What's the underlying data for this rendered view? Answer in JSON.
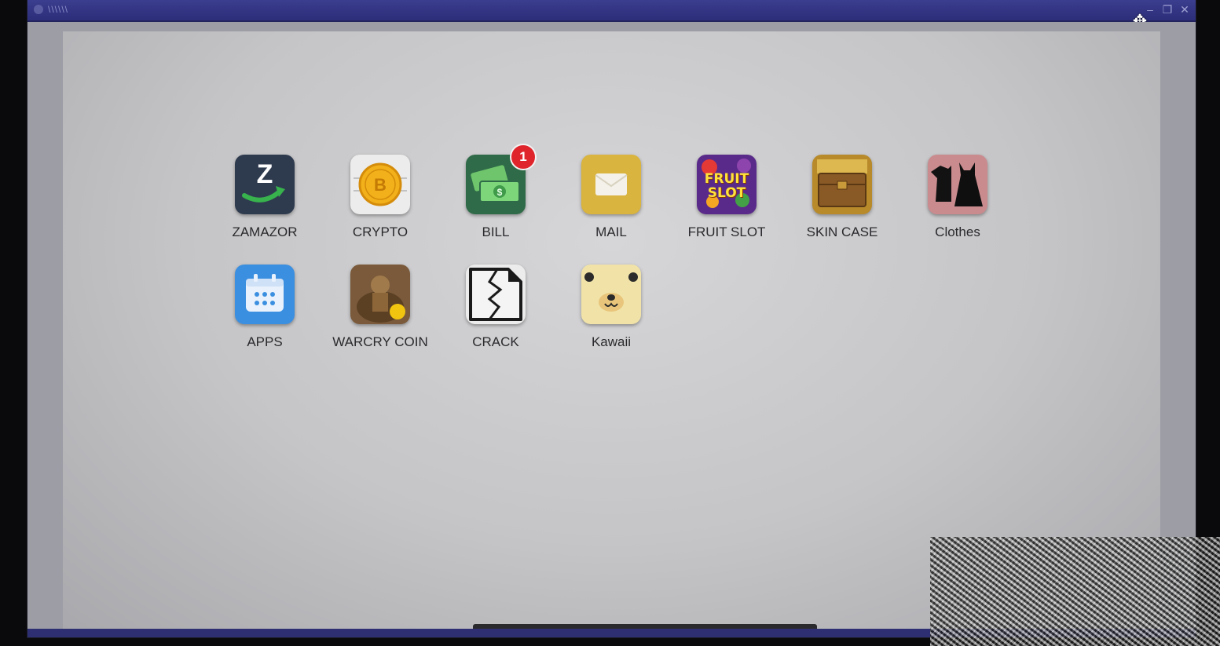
{
  "window": {
    "title": "\\\\\\\\\\\\",
    "minimize_glyph": "–",
    "maximize_glyph": "❐",
    "close_glyph": "✕",
    "move_cursor_glyph": "✥"
  },
  "desktop": {
    "apps": [
      {
        "id": "zamazor",
        "label": "ZAMAZOR",
        "icon": "zamazor-icon",
        "color": "#2e3a4e"
      },
      {
        "id": "crypto",
        "label": "CRYPTO",
        "icon": "bitcoin-icon",
        "color": "#ececec"
      },
      {
        "id": "bill",
        "label": "BILL",
        "icon": "money-icon",
        "color": "#2f6b48",
        "badge": "1"
      },
      {
        "id": "mail",
        "label": "MAIL",
        "icon": "envelope-icon",
        "color": "#d9b43e"
      },
      {
        "id": "fruit-slot",
        "label": "FRUIT SLOT",
        "icon": "fruit-slot-icon",
        "color": "#5a2a8a",
        "logo_text": "FRUIT SLOT"
      },
      {
        "id": "skin-case",
        "label": "SKIN CASE",
        "icon": "treasure-chest-icon",
        "color": "#b88a2a"
      },
      {
        "id": "clothes",
        "label": "Clothes",
        "icon": "dress-icon",
        "color": "#c98b8e"
      },
      {
        "id": "apps",
        "label": "APPS",
        "icon": "calendar-icon",
        "color": "#3b8fe0"
      },
      {
        "id": "warcry-coin",
        "label": "WARCRY COIN",
        "icon": "warrior-icon",
        "color": "#7a5a3a"
      },
      {
        "id": "crack",
        "label": "CRACK",
        "icon": "cracked-file-icon",
        "color": "#ececec"
      },
      {
        "id": "kawaii",
        "label": "Kawaii",
        "icon": "bear-icon",
        "color": "#f1e3a8"
      }
    ]
  }
}
